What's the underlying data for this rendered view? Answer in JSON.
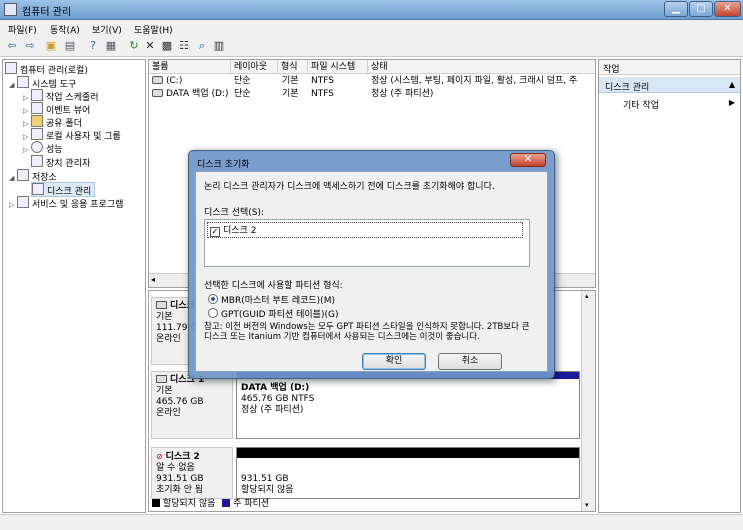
{
  "window": {
    "title": "컴퓨터 관리",
    "controls": {
      "minimize": "▁",
      "maximize": "□",
      "close": "✕"
    }
  },
  "menu": [
    "파일(F)",
    "동작(A)",
    "보기(V)",
    "도움말(H)"
  ],
  "toolbar": [
    "back-arrow-icon",
    "forward-arrow-icon",
    "folder-up-icon",
    "tree-toggle-icon",
    "help-icon",
    "properties-icon",
    "refresh-icon",
    "delete-icon",
    "open-icon",
    "settings-icon",
    "zoom-icon",
    "disk-icon"
  ],
  "tree": [
    {
      "label": "컴퓨터 관리(로컬)",
      "level": 0,
      "exp": ""
    },
    {
      "label": "시스템 도구",
      "level": 1,
      "exp": "◢"
    },
    {
      "label": "작업 스케줄러",
      "level": 2,
      "exp": "▷"
    },
    {
      "label": "이벤트 뷰어",
      "level": 2,
      "exp": "▷"
    },
    {
      "label": "공유 폴더",
      "level": 2,
      "exp": "▷"
    },
    {
      "label": "로컬 사용자 및 그룹",
      "level": 2,
      "exp": "▷"
    },
    {
      "label": "성능",
      "level": 2,
      "exp": "▷"
    },
    {
      "label": "장치 관리자",
      "level": 2,
      "exp": ""
    },
    {
      "label": "저장소",
      "level": 1,
      "exp": "◢"
    },
    {
      "label": "디스크 관리",
      "level": 2,
      "exp": "",
      "selected": true
    },
    {
      "label": "서비스 및 응용 프로그램",
      "level": 1,
      "exp": "▷"
    }
  ],
  "volumes": {
    "headers": [
      "볼륨",
      "레이아웃",
      "형식",
      "파일 시스템",
      "상태"
    ],
    "rows": [
      [
        "(C:)",
        "단순",
        "기본",
        "NTFS",
        "정상 (시스템, 부팅, 페이지 파일, 활성, 크래시 덤프, 주"
      ],
      [
        "DATA 백업 (D:)",
        "단순",
        "기본",
        "NTFS",
        "정상 (주 파티션)"
      ]
    ]
  },
  "disks": [
    {
      "name": "디스크 0",
      "lines": [
        "기본",
        "111.79 GB",
        "온라인"
      ],
      "part": null
    },
    {
      "name": "디스크 1",
      "lines": [
        "기본",
        "465.76 GB",
        "온라인"
      ],
      "part": {
        "title": "DATA 백업  (D:)",
        "lines": [
          "465.76 GB NTFS",
          "정상 (주 파티션)"
        ],
        "bar": "#1a1aa0"
      }
    },
    {
      "name": "디스크 2",
      "lines": [
        "알 수 없음",
        "931.51 GB",
        "초기화 안 됨"
      ],
      "part": {
        "title": "",
        "lines": [
          "931.51 GB",
          "할당되지 않음"
        ],
        "bar": "#000000"
      }
    }
  ],
  "legend": [
    {
      "label": "할당되지 않음",
      "color": "#000000"
    },
    {
      "label": "주 파티션",
      "color": "#1a1aa0"
    }
  ],
  "actions": {
    "header": "작업",
    "section": "디스크 관리",
    "item": "기타 작업"
  },
  "dialog": {
    "title": "디스크 초기화",
    "description": "논리 디스크 관리자가 디스크에 액세스하기 전에 디스크를 초기화해야 합니다.",
    "select_label": "디스크 선택(S):",
    "disk_item": "디스크 2",
    "style_label": "선택한 디스크에 사용할 파티션 형식:",
    "option_mbr": "MBR(마스터 부트 레코드)(M)",
    "option_gpt": "GPT(GUID 파티션 테이블)(G)",
    "note": "참고: 이전 버전의 Windows는 모두 GPT 파티션 스타일을 인식하지 못합니다. 2TB보다 큰 디스크 또는 Itanium 기반 컴퓨터에서 사용되는 디스크에는 이것이 좋습니다.",
    "ok": "확인",
    "cancel": "취소"
  }
}
